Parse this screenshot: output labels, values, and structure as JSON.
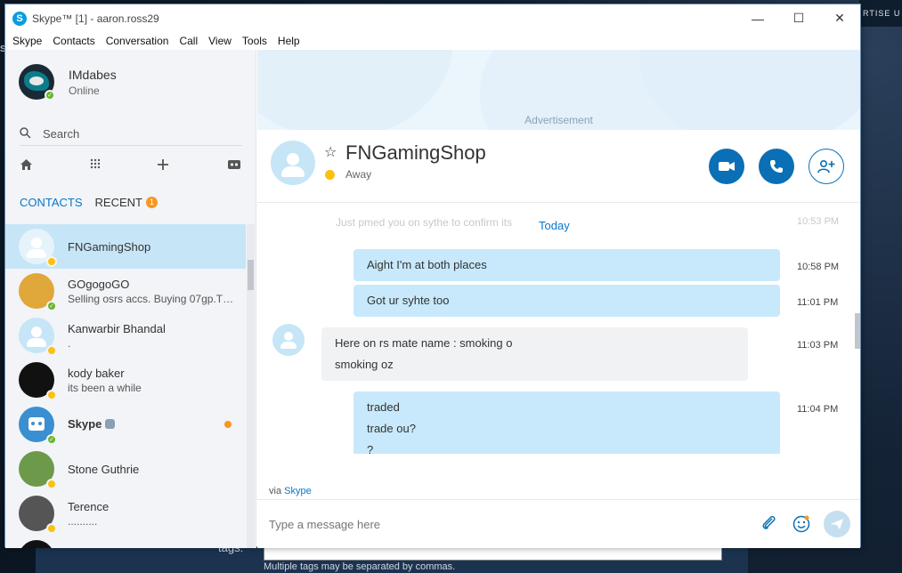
{
  "window": {
    "title": "Skype™ [1] - aaron.ross29",
    "minimize": "—",
    "maximize": "☐",
    "close": "✕"
  },
  "menu": [
    "Skype",
    "Contacts",
    "Conversation",
    "Call",
    "View",
    "Tools",
    "Help"
  ],
  "profile": {
    "name": "IMdabes",
    "status": "Online"
  },
  "search": {
    "placeholder": "Search"
  },
  "tabs": {
    "contacts": "CONTACTS",
    "recent": "RECENT",
    "recent_count": "1"
  },
  "contacts": [
    {
      "name": "FNGamingShop",
      "mood": "",
      "status": "away",
      "selected": true
    },
    {
      "name": "GOgogoGO",
      "mood": "Selling osrs accs. Buying 07gp.Th...",
      "status": "online"
    },
    {
      "name": "Kanwarbir Bhandal",
      "mood": ".",
      "status": "away"
    },
    {
      "name": "kody baker",
      "mood": "its been a while",
      "status": "away"
    },
    {
      "name": "Skype",
      "mood": "",
      "status": "online",
      "bold": true,
      "unread": true
    },
    {
      "name": "Stone Guthrie",
      "mood": "",
      "status": "away"
    },
    {
      "name": "Terence",
      "mood": "..........",
      "status": "away"
    }
  ],
  "ad": {
    "label": "Advertisement"
  },
  "chat": {
    "name": "FNGamingShop",
    "status": "Away",
    "faded_message": "Just pmed you on sythe to confirm its",
    "faded_time": "10:53 PM",
    "date_divider": "Today",
    "messages": [
      {
        "dir": "out",
        "lines": [
          "Aight I'm at both places"
        ],
        "time": "10:58 PM"
      },
      {
        "dir": "out",
        "lines": [
          "Got ur syhte too"
        ],
        "time": "11:01 PM"
      },
      {
        "dir": "in",
        "lines": [
          "Here on rs mate name : smoking o",
          "smoking oz"
        ],
        "time": "11:03 PM"
      },
      {
        "dir": "out",
        "lines": [
          "traded",
          "trade ou?",
          "?"
        ],
        "time": "11:04 PM"
      }
    ],
    "via_prefix": "via",
    "via_link": "Skype",
    "input_placeholder": "Type a message here"
  },
  "desktop": {
    "top_text": "RTISE U",
    "left_text": "S",
    "tags_label": "tags:",
    "tags_hint": "Multiple tags may be separated by commas."
  },
  "colors": {
    "accent": "#0a6fb5",
    "selected_row": "#c6e5f7",
    "online": "#68b42a",
    "away": "#fbc10f",
    "unread": "#f8971d"
  }
}
